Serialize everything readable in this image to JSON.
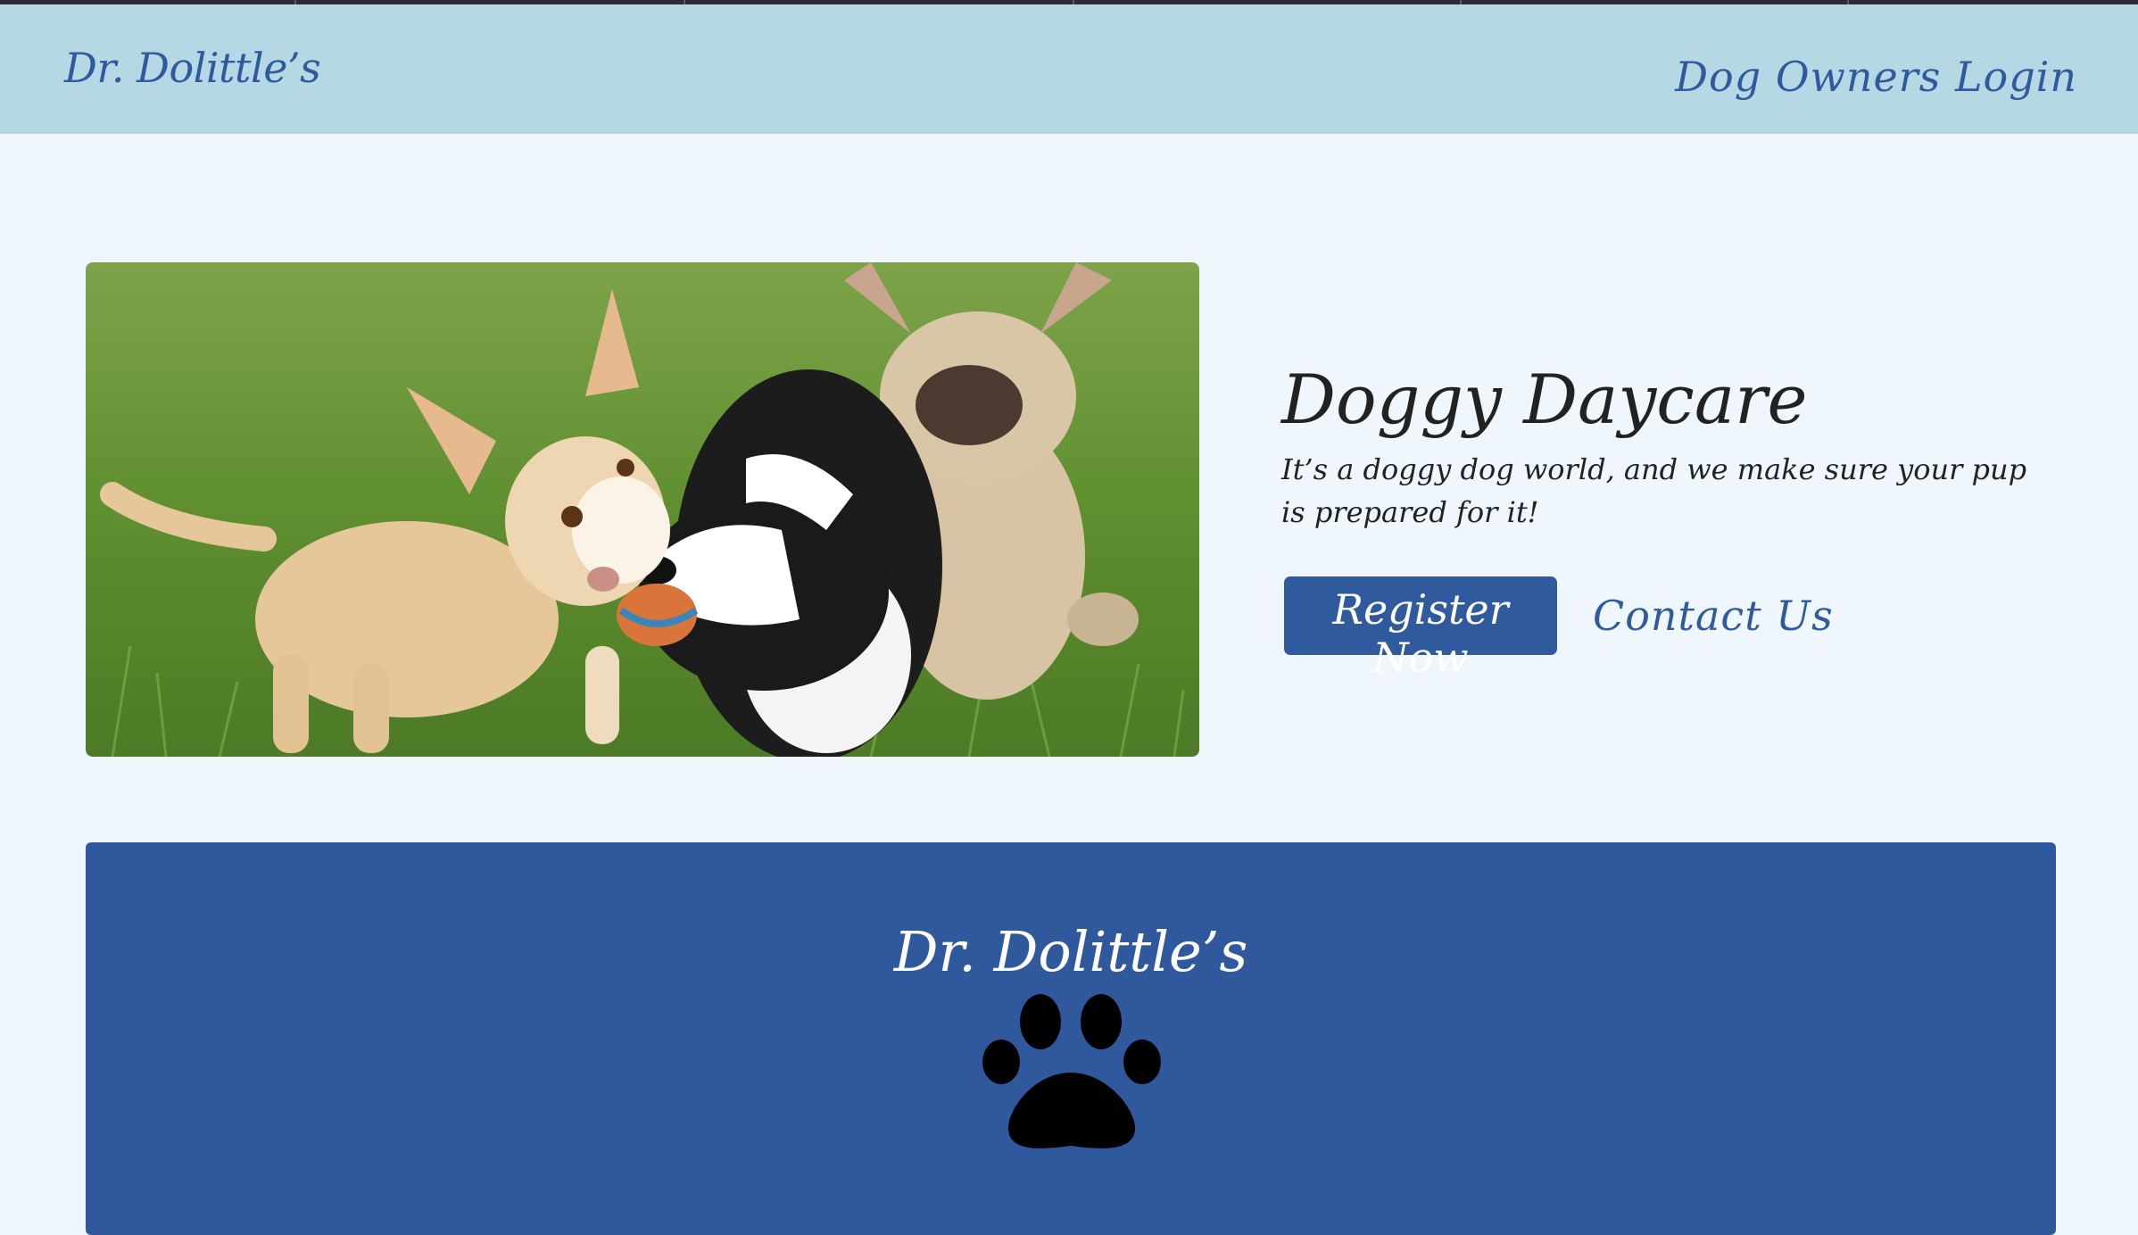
{
  "navbar": {
    "brand": "Dr. Dolittle’s",
    "login_label": "Dog Owners Login",
    "bg_color": "#b5d8e4",
    "accent_color": "#2f5a9e"
  },
  "hero": {
    "image_alt": "Three dogs playing with a ball on grass",
    "title": "Doggy Daycare",
    "subtitle": "It’s a doggy dog world, and we make sure your pup is prepared for it!",
    "register_label": "Register Now",
    "contact_label": "Contact Us"
  },
  "footer": {
    "title": "Dr. Dolittle’s",
    "icon": "paw-icon",
    "bg_color": "#30599d"
  }
}
